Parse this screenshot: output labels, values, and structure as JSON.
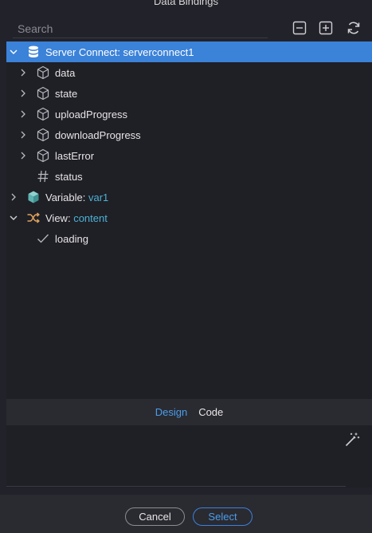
{
  "window": {
    "title": "Data Bindings"
  },
  "search": {
    "placeholder": "Search"
  },
  "toolbar": {
    "collapse_icon": "minus-square-icon",
    "expand_icon": "plus-square-icon",
    "refresh_icon": "refresh-icon"
  },
  "tree": {
    "server_connect": {
      "label": "Server Connect: serverconnect1",
      "icon": "database-icon"
    },
    "children": [
      {
        "label": "data",
        "icon": "cube-icon"
      },
      {
        "label": "state",
        "icon": "cube-icon"
      },
      {
        "label": "uploadProgress",
        "icon": "cube-icon"
      },
      {
        "label": "downloadProgress",
        "icon": "cube-icon"
      },
      {
        "label": "lastError",
        "icon": "cube-icon"
      },
      {
        "label": "status",
        "icon": "hash-icon"
      }
    ],
    "variable": {
      "prefix": "Variable:",
      "value": "var1",
      "icon": "filled-cube-icon"
    },
    "view": {
      "prefix": "View:",
      "value": "content",
      "icon": "shuffle-icon"
    },
    "view_children": [
      {
        "label": "loading",
        "icon": "check-icon"
      }
    ]
  },
  "tabs": {
    "design": "Design",
    "code": "Code"
  },
  "footer": {
    "cancel": "Cancel",
    "select": "Select"
  },
  "colors": {
    "selected": "#3b82d9",
    "accent": "#4a9eea",
    "value": "#4cb3d4",
    "background": "#1f1f26"
  }
}
